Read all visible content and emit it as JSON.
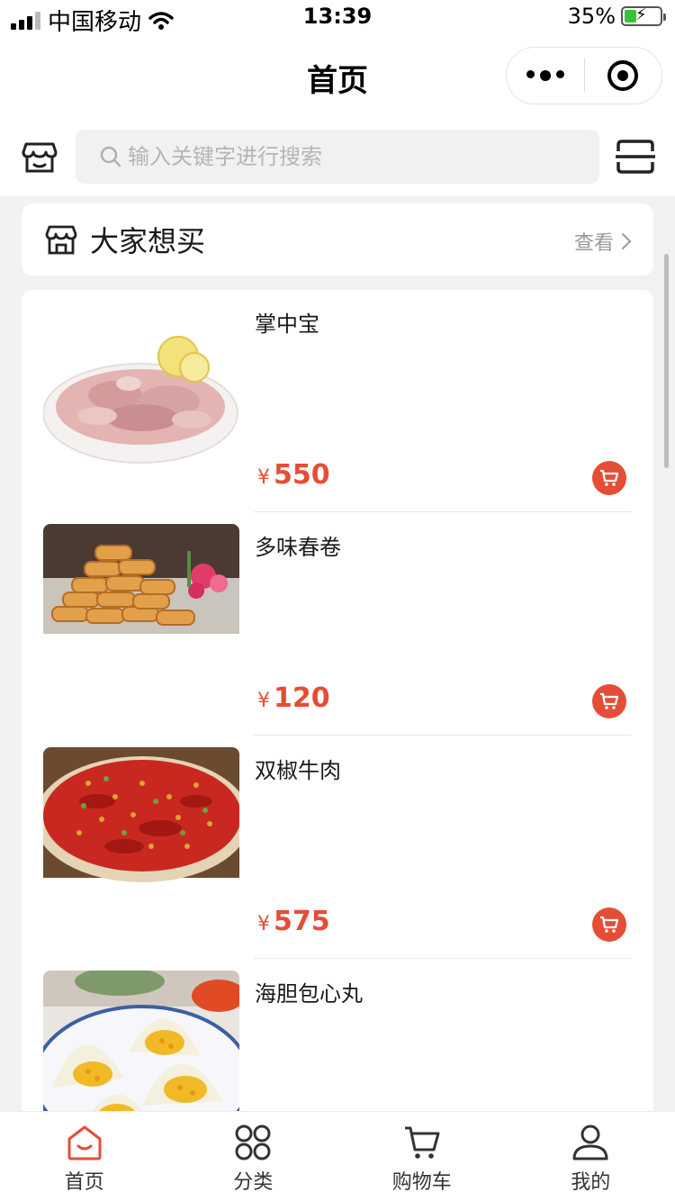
{
  "status_bar": {
    "carrier": "中国移动",
    "time": "13:39",
    "battery": "35%",
    "battery_level": 0.35
  },
  "nav": {
    "title": "首页",
    "more_icon": "more-dots-icon",
    "close_icon": "target-close-icon"
  },
  "search": {
    "placeholder": "输入关键字进行搜索",
    "left_icon": "store-icon",
    "right_icon": "scan-icon"
  },
  "want_section": {
    "title": "大家想买",
    "more_label": "查看"
  },
  "products": [
    {
      "name": "掌中宝",
      "currency": "¥",
      "price": "550",
      "image": "pork-cartilage-dish"
    },
    {
      "name": "多味春卷",
      "currency": "¥",
      "price": "120",
      "image": "spring-rolls-dish"
    },
    {
      "name": "双椒牛肉",
      "currency": "¥",
      "price": "575",
      "image": "pepper-beef-dish"
    },
    {
      "name": "海胆包心丸",
      "currency": "¥",
      "price": "",
      "image": "sea-urchin-balls-dish"
    }
  ],
  "tabs": [
    {
      "label": "首页",
      "icon": "home-icon",
      "active": true
    },
    {
      "label": "分类",
      "icon": "category-icon",
      "active": false
    },
    {
      "label": "购物车",
      "icon": "cart-icon",
      "active": false
    },
    {
      "label": "我的",
      "icon": "user-icon",
      "active": false
    }
  ],
  "colors": {
    "accent": "#e54d36",
    "background": "#f2f2f2"
  }
}
